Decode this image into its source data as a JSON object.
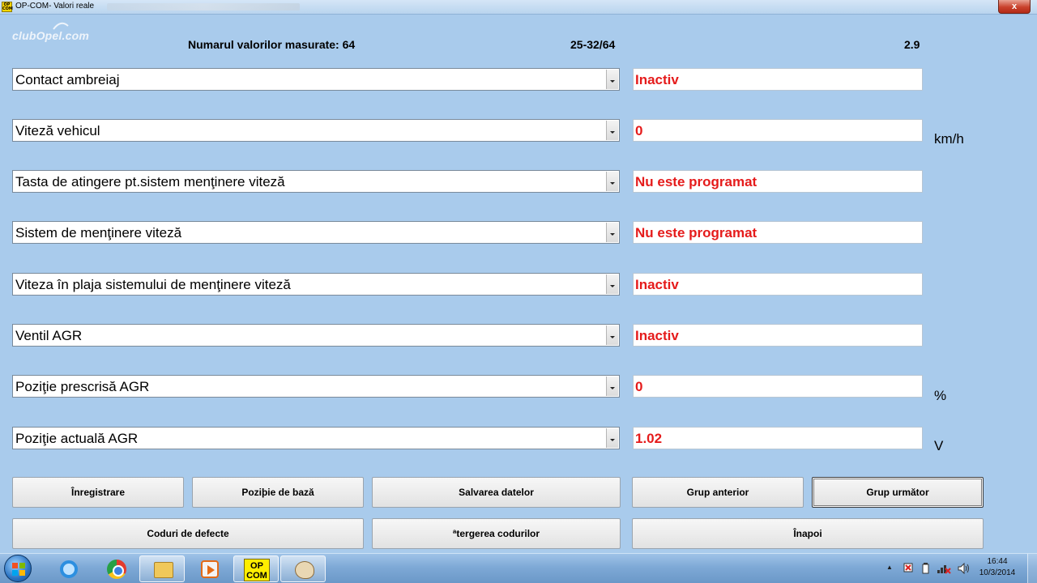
{
  "window": {
    "title": "OP-COM- Valori reale",
    "icon_text": "OP COM",
    "close_label": "x"
  },
  "logo": {
    "text": "clubOpel.com"
  },
  "header": {
    "count_label": "Numarul valorilor masurate: 64",
    "range": "25-32/64",
    "version": "2.9"
  },
  "params": [
    {
      "label": "Contact ambreiaj",
      "value": "Inactiv",
      "unit": ""
    },
    {
      "label": "Viteză vehicul",
      "value": "0",
      "unit": "km/h"
    },
    {
      "label": "Tasta de atingere pt.sistem menţinere viteză",
      "value": "Nu este programat",
      "unit": ""
    },
    {
      "label": "Sistem de menţinere viteză",
      "value": "Nu este programat",
      "unit": ""
    },
    {
      "label": "Viteza în plaja sistemului de menţinere viteză",
      "value": "Inactiv",
      "unit": ""
    },
    {
      "label": "Ventil AGR",
      "value": "Inactiv",
      "unit": ""
    },
    {
      "label": "Poziţie prescrisă AGR",
      "value": "0",
      "unit": "%"
    },
    {
      "label": "Poziţie actuală AGR",
      "value": "1.02",
      "unit": "V"
    }
  ],
  "buttons": {
    "record": "Înregistrare",
    "base_position": "Poziþie de bază",
    "save_data": "Salvarea datelor",
    "prev_group": "Grup anterior",
    "next_group": "Grup următor",
    "fault_codes": "Coduri de defecte",
    "erase_codes": "ªtergerea codurilor",
    "back": "Înapoi"
  },
  "taskbar": {
    "opcom_label": "OP COM",
    "time": "16:44",
    "date": "10/3/2014",
    "tray_arrow": "▲"
  },
  "colors": {
    "background": "#a9cbec",
    "value_text": "#e51b1b",
    "taskbar": "#7ea9d6"
  },
  "icons": [
    "windows-start-icon",
    "internet-explorer-icon",
    "chrome-icon",
    "file-explorer-icon",
    "media-player-icon",
    "opcom-icon",
    "paint-icon",
    "flag-tray-icon",
    "battery-icon",
    "network-icon",
    "volume-icon"
  ]
}
